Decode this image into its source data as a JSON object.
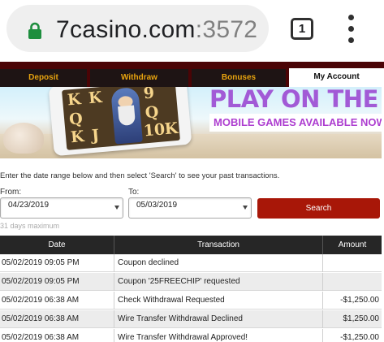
{
  "browser": {
    "url_host": "7casino.com",
    "url_port": ":3572",
    "tab_count": "1",
    "icons": [
      "lock-icon",
      "tabs-icon",
      "more-vert-icon"
    ],
    "lock_color": "#1e8e3e"
  },
  "nav": {
    "tabs": [
      {
        "label": "Deposit"
      },
      {
        "label": "Withdraw"
      },
      {
        "label": "Bonuses"
      },
      {
        "label": "My Account",
        "active": true
      }
    ],
    "accent": "#e7a30f",
    "bar_color": "#4a0406"
  },
  "banner": {
    "slot_symbols": [
      "K",
      "K",
      "Q",
      "J",
      "K",
      "9",
      "Q",
      "10",
      "K"
    ],
    "headline": "PLAY ON THE GO!",
    "subline": "MOBILE GAMES AVAILABLE NOW!"
  },
  "form": {
    "instructions": "Enter the date range below and then select 'Search' to see your past transactions.",
    "from_label": "From:",
    "from_value": "04/23/2019",
    "to_label": "To:",
    "to_value": "05/03/2019",
    "search_label": "Search",
    "max_note": "31 days maximum",
    "button_color": "#a81708"
  },
  "table": {
    "headers": [
      "Date",
      "Transaction",
      "Amount"
    ],
    "rows": [
      {
        "date": "05/02/2019 09:05 PM",
        "transaction": "Coupon declined",
        "amount": ""
      },
      {
        "date": "05/02/2019 09:05 PM",
        "transaction": "Coupon '25FREECHIP' requested",
        "amount": ""
      },
      {
        "date": "05/02/2019 06:38 AM",
        "transaction": "Check Withdrawal Requested",
        "amount": "-$1,250.00"
      },
      {
        "date": "05/02/2019 06:38 AM",
        "transaction": "Wire Transfer Withdrawal Declined",
        "amount": "$1,250.00"
      },
      {
        "date": "05/02/2019 06:38 AM",
        "transaction": "Wire Transfer Withdrawal Approved!",
        "amount": "-$1,250.00"
      }
    ]
  }
}
